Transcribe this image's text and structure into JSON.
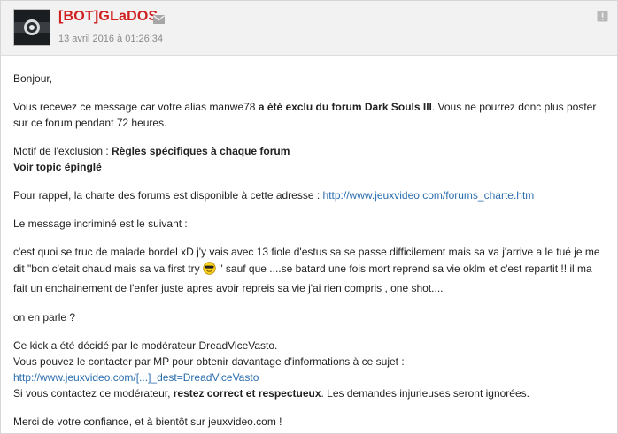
{
  "header": {
    "author": "[BOT]GLaDOS",
    "date": "13 avril 2016 à 01:26:34",
    "icons": {
      "mail": "mail-icon",
      "report": "report-icon"
    },
    "author_color": "#d01f1f"
  },
  "message": {
    "greeting": "Bonjour,",
    "p1_pre": "Vous recevez ce message car votre alias manwe78 ",
    "p1_bold": "a été exclu du forum Dark Souls III",
    "p1_post": ". Vous ne pourrez donc plus poster sur ce forum pendant 72 heures.",
    "motif_label": "Motif de l'exclusion : ",
    "motif_value": "Règles spécifiques à chaque forum",
    "topic_link": "Voir topic épinglé",
    "charte_text": "Pour rappel, la charte des forums est disponible à cette adresse : ",
    "charte_url": "http://www.jeuxvideo.com/forums_charte.htm",
    "incrimine": "Le message incriminé est le suivant :",
    "quote_pre": "c'est quoi se truc de malade bordel xD j'y vais avec 13 fiole d'estus sa se passe difficilement mais sa va j'arrive a le tué je me dit \"bon c'etait chaud mais sa va first try ",
    "quote_post": " \" sauf que ....se batard une fois mort reprend sa vie oklm et c'est repartit !! il ma fait un enchainement de l'enfer juste apres avoir repreis sa vie j'ai rien compris , one shot....",
    "en_parle": "on en parle ?",
    "kick_line": "Ce kick a été décidé par le modérateur DreadViceVasto.",
    "contact_text": "Vous pouvez le contacter par MP pour obtenir davantage d'informations à ce sujet : ",
    "contact_url": "http://www.jeuxvideo.com/[...]_dest=DreadViceVasto",
    "contact2_pre": "Si vous contactez ce modérateur, ",
    "contact2_bold": "restez correct et respectueux",
    "contact2_post": ". Les demandes injurieuses seront ignorées.",
    "closing": "Merci de votre confiance, et à bientôt sur jeuxvideo.com !",
    "link_color": "#2a6dae"
  }
}
